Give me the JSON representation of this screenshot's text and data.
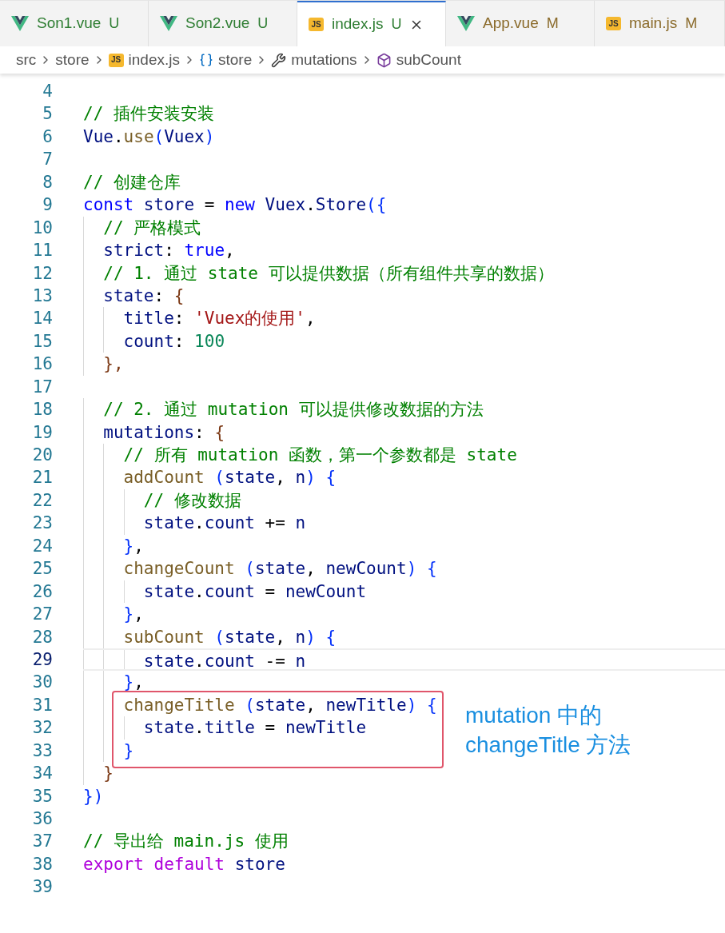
{
  "tabs": [
    {
      "label": "Son1.vue",
      "kind": "vue",
      "status": "U",
      "color": "#2e7d32",
      "selected": false,
      "closable": false
    },
    {
      "label": "Son2.vue",
      "kind": "vue",
      "status": "U",
      "color": "#2e7d32",
      "selected": false,
      "closable": false
    },
    {
      "label": "index.js",
      "kind": "js",
      "icon_text": "JS",
      "status": "U",
      "color": "#2e7d32",
      "selected": true,
      "closable": true
    },
    {
      "label": "App.vue",
      "kind": "vue",
      "status": "M",
      "color": "#8a6a2a",
      "selected": false,
      "closable": false
    },
    {
      "label": "main.js",
      "kind": "js",
      "icon_text": "JS",
      "status": "M",
      "color": "#8a6a2a",
      "selected": false,
      "closable": false
    }
  ],
  "breadcrumb": [
    {
      "label": "src",
      "kind": "folder"
    },
    {
      "label": "store",
      "kind": "folder"
    },
    {
      "label": "index.js",
      "kind": "js",
      "icon_text": "JS"
    },
    {
      "label": "store",
      "kind": "variable"
    },
    {
      "label": "mutations",
      "kind": "property"
    },
    {
      "label": "subCount",
      "kind": "method"
    }
  ],
  "lines": [
    {
      "n": "4",
      "current": false,
      "boxed": false
    },
    {
      "n": "5",
      "tokens": [
        {
          "text": "// 插件安装安装",
          "kind": "comment"
        }
      ],
      "current": false,
      "boxed": false
    },
    {
      "n": "6",
      "tokens": [
        {
          "text": "Vue",
          "kind": "variable"
        },
        {
          "text": ".",
          "kind": "plain"
        },
        {
          "text": "use",
          "kind": "function"
        },
        {
          "text": "(",
          "kind": "bracket"
        },
        {
          "text": "Vuex",
          "kind": "variable"
        },
        {
          "text": ")",
          "kind": "bracket"
        }
      ],
      "current": false,
      "boxed": false
    },
    {
      "n": "7",
      "current": false,
      "boxed": false
    },
    {
      "n": "8",
      "tokens": [
        {
          "text": "// 创建仓库",
          "kind": "comment"
        }
      ],
      "current": false,
      "boxed": false
    },
    {
      "n": "9",
      "tokens": [
        {
          "text": "const",
          "kind": "keyword"
        },
        {
          "text": " store",
          "kind": "variable"
        },
        {
          "text": " = ",
          "kind": "plain"
        },
        {
          "text": "new",
          "kind": "keyword"
        },
        {
          "text": " Vuex",
          "kind": "variable"
        },
        {
          "text": ".",
          "kind": "plain"
        },
        {
          "text": "Store",
          "kind": "variable"
        },
        {
          "text": "({",
          "kind": "bracket"
        }
      ],
      "current": false,
      "boxed": false
    },
    {
      "n": "10",
      "tokens": [
        {
          "text": "  // 严格模式",
          "kind": "comment"
        }
      ],
      "current": false,
      "boxed": false
    },
    {
      "n": "11",
      "tokens": [
        {
          "text": "  strict",
          "kind": "variable"
        },
        {
          "text": ": ",
          "kind": "plain"
        },
        {
          "text": "true",
          "kind": "keyword"
        },
        {
          "text": ",",
          "kind": "plain"
        }
      ],
      "current": false,
      "boxed": false
    },
    {
      "n": "12",
      "tokens": [
        {
          "text": "  // 1. 通过 state 可以提供数据（所有组件共享的数据）",
          "kind": "comment"
        }
      ],
      "current": false,
      "boxed": false
    },
    {
      "n": "13",
      "tokens": [
        {
          "text": "  state",
          "kind": "variable"
        },
        {
          "text": ": ",
          "kind": "plain"
        },
        {
          "text": "{",
          "kind": "bracket2"
        }
      ],
      "current": false,
      "boxed": false
    },
    {
      "n": "14",
      "tokens": [
        {
          "text": "    title",
          "kind": "variable"
        },
        {
          "text": ": ",
          "kind": "plain"
        },
        {
          "text": "'Vuex的使用'",
          "kind": "string"
        },
        {
          "text": ",",
          "kind": "plain"
        }
      ],
      "current": false,
      "boxed": false
    },
    {
      "n": "15",
      "tokens": [
        {
          "text": "    count",
          "kind": "variable"
        },
        {
          "text": ": ",
          "kind": "plain"
        },
        {
          "text": "100",
          "kind": "number"
        }
      ],
      "current": false,
      "boxed": false
    },
    {
      "n": "16",
      "tokens": [
        {
          "text": "  },",
          "kind": "bracket2"
        }
      ],
      "current": false,
      "boxed": false
    },
    {
      "n": "17",
      "current": false,
      "boxed": false
    },
    {
      "n": "18",
      "tokens": [
        {
          "text": "  // 2. 通过 mutation 可以提供修改数据的方法",
          "kind": "comment"
        }
      ],
      "current": false,
      "boxed": false
    },
    {
      "n": "19",
      "tokens": [
        {
          "text": "  mutations",
          "kind": "variable"
        },
        {
          "text": ": ",
          "kind": "plain"
        },
        {
          "text": "{",
          "kind": "bracket2"
        }
      ],
      "current": false,
      "boxed": false
    },
    {
      "n": "20",
      "tokens": [
        {
          "text": "    // 所有 mutation 函数，第一个参数都是 state",
          "kind": "comment"
        }
      ],
      "current": false,
      "boxed": false
    },
    {
      "n": "21",
      "tokens": [
        {
          "text": "    addCount",
          "kind": "function"
        },
        {
          "text": " (",
          "kind": "bracket"
        },
        {
          "text": "state",
          "kind": "variable"
        },
        {
          "text": ", ",
          "kind": "plain"
        },
        {
          "text": "n",
          "kind": "variable"
        },
        {
          "text": ") {",
          "kind": "bracket"
        }
      ],
      "current": false,
      "boxed": false
    },
    {
      "n": "22",
      "tokens": [
        {
          "text": "      // 修改数据",
          "kind": "comment"
        }
      ],
      "current": false,
      "boxed": false
    },
    {
      "n": "23",
      "tokens": [
        {
          "text": "      state",
          "kind": "variable"
        },
        {
          "text": ".",
          "kind": "plain"
        },
        {
          "text": "count",
          "kind": "variable"
        },
        {
          "text": " += ",
          "kind": "plain"
        },
        {
          "text": "n",
          "kind": "variable"
        }
      ],
      "current": false,
      "boxed": false
    },
    {
      "n": "24",
      "tokens": [
        {
          "text": "    }",
          "kind": "bracket"
        },
        {
          "text": ",",
          "kind": "plain"
        }
      ],
      "current": false,
      "boxed": false
    },
    {
      "n": "25",
      "tokens": [
        {
          "text": "    changeCount",
          "kind": "function"
        },
        {
          "text": " (",
          "kind": "bracket"
        },
        {
          "text": "state",
          "kind": "variable"
        },
        {
          "text": ", ",
          "kind": "plain"
        },
        {
          "text": "newCount",
          "kind": "variable"
        },
        {
          "text": ") {",
          "kind": "bracket"
        }
      ],
      "current": false,
      "boxed": false
    },
    {
      "n": "26",
      "tokens": [
        {
          "text": "      state",
          "kind": "variable"
        },
        {
          "text": ".",
          "kind": "plain"
        },
        {
          "text": "count",
          "kind": "variable"
        },
        {
          "text": " = ",
          "kind": "plain"
        },
        {
          "text": "newCount",
          "kind": "variable"
        }
      ],
      "current": false,
      "boxed": false
    },
    {
      "n": "27",
      "tokens": [
        {
          "text": "    }",
          "kind": "bracket"
        },
        {
          "text": ",",
          "kind": "plain"
        }
      ],
      "current": false,
      "boxed": false
    },
    {
      "n": "28",
      "tokens": [
        {
          "text": "    subCount",
          "kind": "function"
        },
        {
          "text": " (",
          "kind": "bracket"
        },
        {
          "text": "state",
          "kind": "variable"
        },
        {
          "text": ", ",
          "kind": "plain"
        },
        {
          "text": "n",
          "kind": "variable"
        },
        {
          "text": ") {",
          "kind": "bracket"
        }
      ],
      "current": false,
      "boxed": false
    },
    {
      "n": "29",
      "tokens": [
        {
          "text": "      state",
          "kind": "variable"
        },
        {
          "text": ".",
          "kind": "plain"
        },
        {
          "text": "count",
          "kind": "variable"
        },
        {
          "text": " -= ",
          "kind": "plain"
        },
        {
          "text": "n",
          "kind": "variable"
        }
      ],
      "current": true,
      "boxed": false
    },
    {
      "n": "30",
      "tokens": [
        {
          "text": "    }",
          "kind": "bracket"
        },
        {
          "text": ",",
          "kind": "plain"
        }
      ],
      "current": false,
      "boxed": false
    },
    {
      "n": "31",
      "tokens": [
        {
          "text": "    changeTitle",
          "kind": "function"
        },
        {
          "text": " (",
          "kind": "bracket"
        },
        {
          "text": "state",
          "kind": "variable"
        },
        {
          "text": ", ",
          "kind": "plain"
        },
        {
          "text": "newTitle",
          "kind": "variable"
        },
        {
          "text": ") {",
          "kind": "bracket"
        }
      ],
      "current": false,
      "boxed": true
    },
    {
      "n": "32",
      "tokens": [
        {
          "text": "      state",
          "kind": "variable"
        },
        {
          "text": ".",
          "kind": "plain"
        },
        {
          "text": "title",
          "kind": "variable"
        },
        {
          "text": " = ",
          "kind": "plain"
        },
        {
          "text": "newTitle",
          "kind": "variable"
        }
      ],
      "current": false,
      "boxed": true
    },
    {
      "n": "33",
      "tokens": [
        {
          "text": "    }",
          "kind": "bracket"
        }
      ],
      "current": false,
      "boxed": true
    },
    {
      "n": "34",
      "tokens": [
        {
          "text": "  }",
          "kind": "bracket2"
        }
      ],
      "current": false,
      "boxed": false
    },
    {
      "n": "35",
      "tokens": [
        {
          "text": "})",
          "kind": "bracket"
        }
      ],
      "current": false,
      "boxed": false
    },
    {
      "n": "36",
      "current": false,
      "boxed": false
    },
    {
      "n": "37",
      "tokens": [
        {
          "text": "// 导出给 main.js 使用",
          "kind": "comment"
        }
      ],
      "current": false,
      "boxed": false
    },
    {
      "n": "38",
      "tokens": [
        {
          "text": "export",
          "kind": "keyword2"
        },
        {
          "text": " default",
          "kind": "keyword2"
        },
        {
          "text": " store",
          "kind": "variable"
        }
      ],
      "current": false,
      "boxed": false
    },
    {
      "n": "39",
      "current": false,
      "boxed": false
    }
  ],
  "callout": {
    "lines": [
      "mutation 中的",
      "changeTitle 方法"
    ]
  }
}
